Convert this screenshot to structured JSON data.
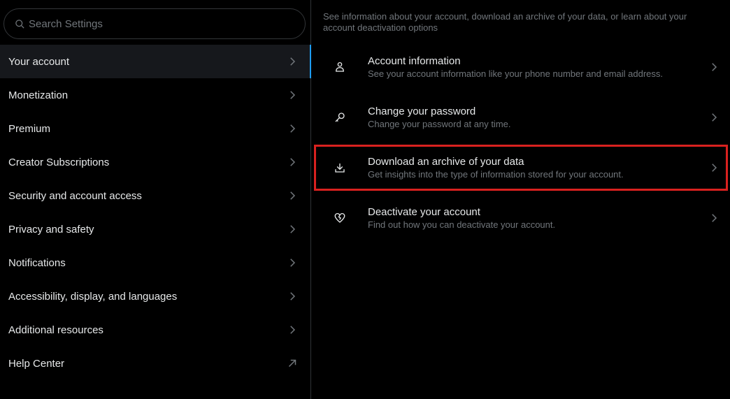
{
  "search": {
    "placeholder": "Search Settings"
  },
  "sidebar": {
    "items": [
      {
        "label": "Your account",
        "active": true,
        "icon": "chevron-right-icon"
      },
      {
        "label": "Monetization",
        "icon": "chevron-right-icon"
      },
      {
        "label": "Premium",
        "icon": "chevron-right-icon"
      },
      {
        "label": "Creator Subscriptions",
        "icon": "chevron-right-icon"
      },
      {
        "label": "Security and account access",
        "icon": "chevron-right-icon"
      },
      {
        "label": "Privacy and safety",
        "icon": "chevron-right-icon"
      },
      {
        "label": "Notifications",
        "icon": "chevron-right-icon"
      },
      {
        "label": "Accessibility, display, and languages",
        "icon": "chevron-right-icon"
      },
      {
        "label": "Additional resources",
        "icon": "chevron-right-icon"
      },
      {
        "label": "Help Center",
        "icon": "external-link-arrow-icon"
      }
    ]
  },
  "main": {
    "intro": "See information about your account, download an archive of your data, or learn about your account deactivation options",
    "options": [
      {
        "title": "Account information",
        "subtitle": "See your account information like your phone number and email address.",
        "icon": "person-icon"
      },
      {
        "title": "Change your password",
        "subtitle": "Change your password at any time.",
        "icon": "key-icon"
      },
      {
        "title": "Download an archive of your data",
        "subtitle": "Get insights into the type of information stored for your account.",
        "icon": "download-icon",
        "highlighted": true
      },
      {
        "title": "Deactivate your account",
        "subtitle": "Find out how you can deactivate your account.",
        "icon": "broken-heart-icon"
      }
    ]
  },
  "colors": {
    "background": "#000000",
    "text": "#e7e9ea",
    "muted": "#71767b",
    "active_bg": "#16181c",
    "accent": "#1d9bf0",
    "highlight_border": "#d9211f"
  }
}
